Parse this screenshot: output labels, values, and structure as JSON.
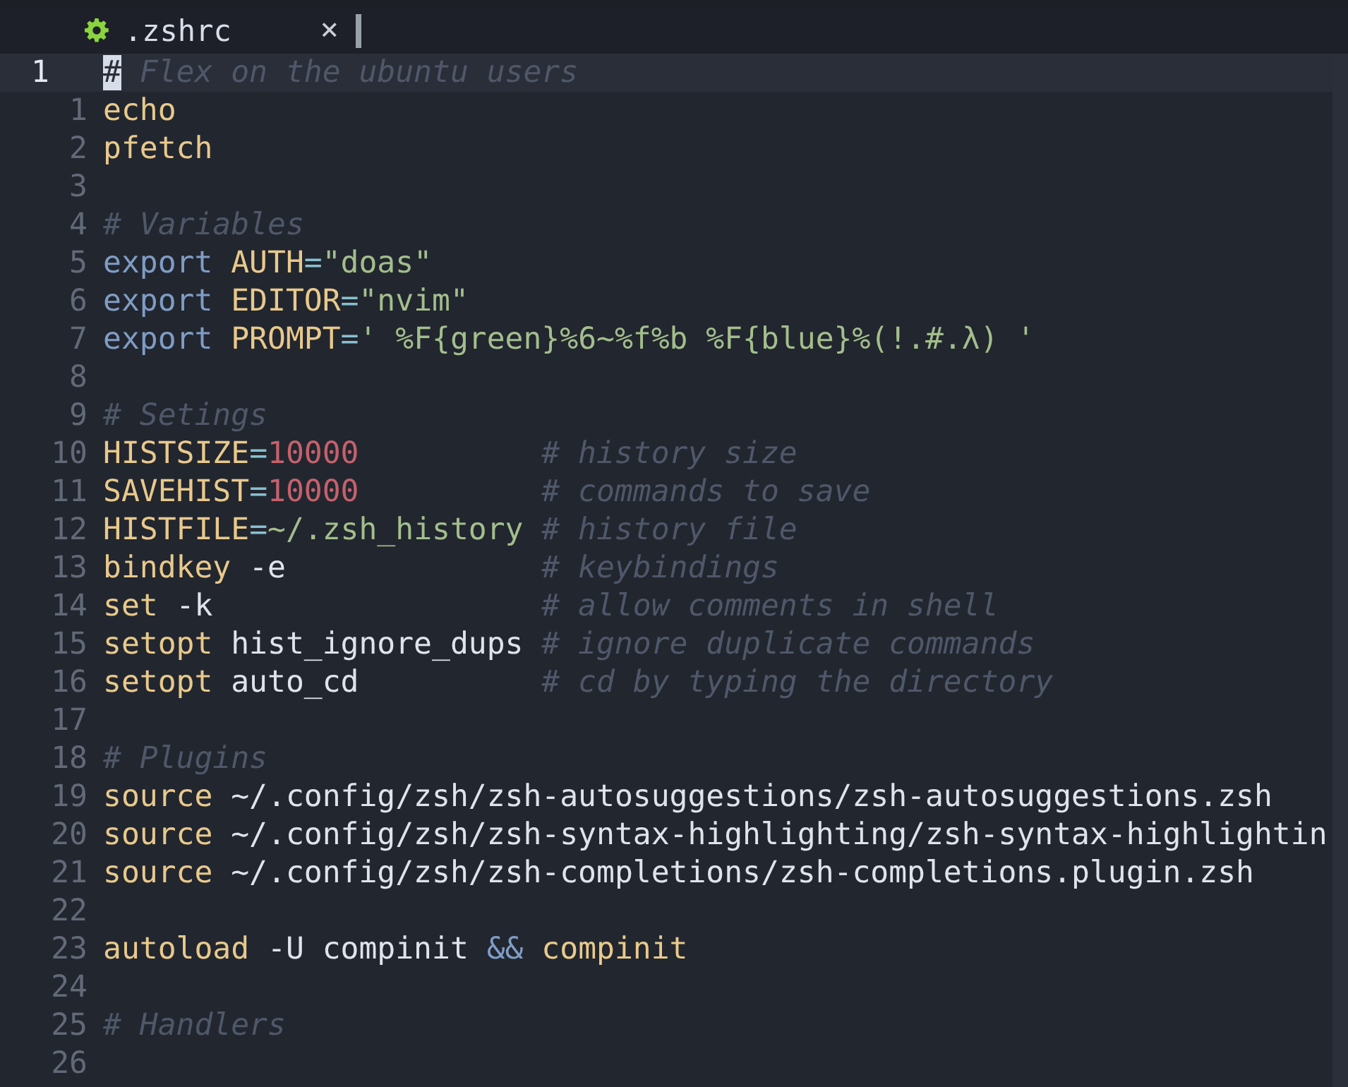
{
  "tab": {
    "title": ".zshrc",
    "close": "×"
  },
  "lines": [
    {
      "number": "1",
      "current": true,
      "tokens": [
        {
          "text": "#",
          "kind": "cursor"
        },
        {
          "text": " Flex on the ubuntu users",
          "kind": "comment"
        }
      ]
    },
    {
      "number": "1",
      "current": false,
      "tokens": [
        {
          "text": "echo",
          "kind": "keyword"
        }
      ]
    },
    {
      "number": "2",
      "current": false,
      "tokens": [
        {
          "text": "pfetch",
          "kind": "keyword"
        }
      ]
    },
    {
      "number": "3",
      "current": false
    },
    {
      "number": "4",
      "current": false,
      "tokens": [
        {
          "text": "# Variables",
          "kind": "comment"
        }
      ]
    },
    {
      "number": "5",
      "current": false,
      "tokens": [
        {
          "text": "export ",
          "kind": "builtin"
        },
        {
          "text": "AUTH",
          "kind": "keyword"
        },
        {
          "text": "=",
          "kind": "operator"
        },
        {
          "text": "\"doas\"",
          "kind": "string"
        }
      ]
    },
    {
      "number": "6",
      "current": false,
      "tokens": [
        {
          "text": "export ",
          "kind": "builtin"
        },
        {
          "text": "EDITOR",
          "kind": "keyword"
        },
        {
          "text": "=",
          "kind": "operator"
        },
        {
          "text": "\"nvim\"",
          "kind": "string"
        }
      ]
    },
    {
      "number": "7",
      "current": false,
      "tokens": [
        {
          "text": "export ",
          "kind": "builtin"
        },
        {
          "text": "PROMPT",
          "kind": "keyword"
        },
        {
          "text": "=",
          "kind": "operator"
        },
        {
          "text": "' %F{green}%6~%f%b %F{blue}%(!.#.λ) '",
          "kind": "string"
        }
      ]
    },
    {
      "number": "8",
      "current": false
    },
    {
      "number": "9",
      "current": false,
      "tokens": [
        {
          "text": "# Setings",
          "kind": "comment"
        }
      ]
    },
    {
      "number": "10",
      "current": false,
      "tokens": [
        {
          "text": "HISTSIZE",
          "kind": "keyword"
        },
        {
          "text": "=",
          "kind": "operator"
        },
        {
          "text": "10000",
          "kind": "number"
        }
      ],
      "trailing_comment": "# history size"
    },
    {
      "number": "11",
      "current": false,
      "tokens": [
        {
          "text": "SAVEHIST",
          "kind": "keyword"
        },
        {
          "text": "=",
          "kind": "operator"
        },
        {
          "text": "10000",
          "kind": "number"
        }
      ],
      "trailing_comment": "# commands to save"
    },
    {
      "number": "12",
      "current": false,
      "tokens": [
        {
          "text": "HISTFILE",
          "kind": "keyword"
        },
        {
          "text": "=",
          "kind": "operator"
        },
        {
          "text": "~/.zsh_history",
          "kind": "string"
        }
      ],
      "trailing_comment": "# history file"
    },
    {
      "number": "13",
      "current": false,
      "tokens": [
        {
          "text": "bindkey",
          "kind": "keyword"
        },
        {
          "text": " -e",
          "kind": "plain"
        }
      ],
      "trailing_comment": "# keybindings"
    },
    {
      "number": "14",
      "current": false,
      "tokens": [
        {
          "text": "set",
          "kind": "keyword"
        },
        {
          "text": " -k",
          "kind": "plain"
        }
      ],
      "trailing_comment": "# allow comments in shell"
    },
    {
      "number": "15",
      "current": false,
      "tokens": [
        {
          "text": "setopt",
          "kind": "keyword"
        },
        {
          "text": " hist_ignore_dups",
          "kind": "plain"
        }
      ],
      "trailing_comment": "# ignore duplicate commands"
    },
    {
      "number": "16",
      "current": false,
      "tokens": [
        {
          "text": "setopt",
          "kind": "keyword"
        },
        {
          "text": " auto_cd",
          "kind": "plain"
        }
      ],
      "trailing_comment": "# cd by typing the directory"
    },
    {
      "number": "17",
      "current": false
    },
    {
      "number": "18",
      "current": false,
      "tokens": [
        {
          "text": "# Plugins",
          "kind": "comment"
        }
      ]
    },
    {
      "number": "19",
      "current": false,
      "tokens": [
        {
          "text": "source",
          "kind": "keyword"
        },
        {
          "text": " ~/.config/zsh/zsh-autosuggestions/zsh-autosuggestions.zsh",
          "kind": "plain"
        }
      ]
    },
    {
      "number": "20",
      "current": false,
      "tokens": [
        {
          "text": "source",
          "kind": "keyword"
        },
        {
          "text": " ~/.config/zsh/zsh-syntax-highlighting/zsh-syntax-highlightin",
          "kind": "plain"
        }
      ]
    },
    {
      "number": "21",
      "current": false,
      "tokens": [
        {
          "text": "source",
          "kind": "keyword"
        },
        {
          "text": " ~/.config/zsh/zsh-completions/zsh-completions.plugin.zsh",
          "kind": "plain"
        }
      ]
    },
    {
      "number": "22",
      "current": false
    },
    {
      "number": "23",
      "current": false,
      "tokens": [
        {
          "text": "autoload",
          "kind": "keyword"
        },
        {
          "text": " -U compinit ",
          "kind": "plain"
        },
        {
          "text": "&&",
          "kind": "builtin"
        },
        {
          "text": " compinit",
          "kind": "keyword"
        }
      ]
    },
    {
      "number": "24",
      "current": false
    },
    {
      "number": "25",
      "current": false,
      "tokens": [
        {
          "text": "# Handlers",
          "kind": "comment"
        }
      ]
    },
    {
      "number": "26",
      "current": false
    }
  ]
}
